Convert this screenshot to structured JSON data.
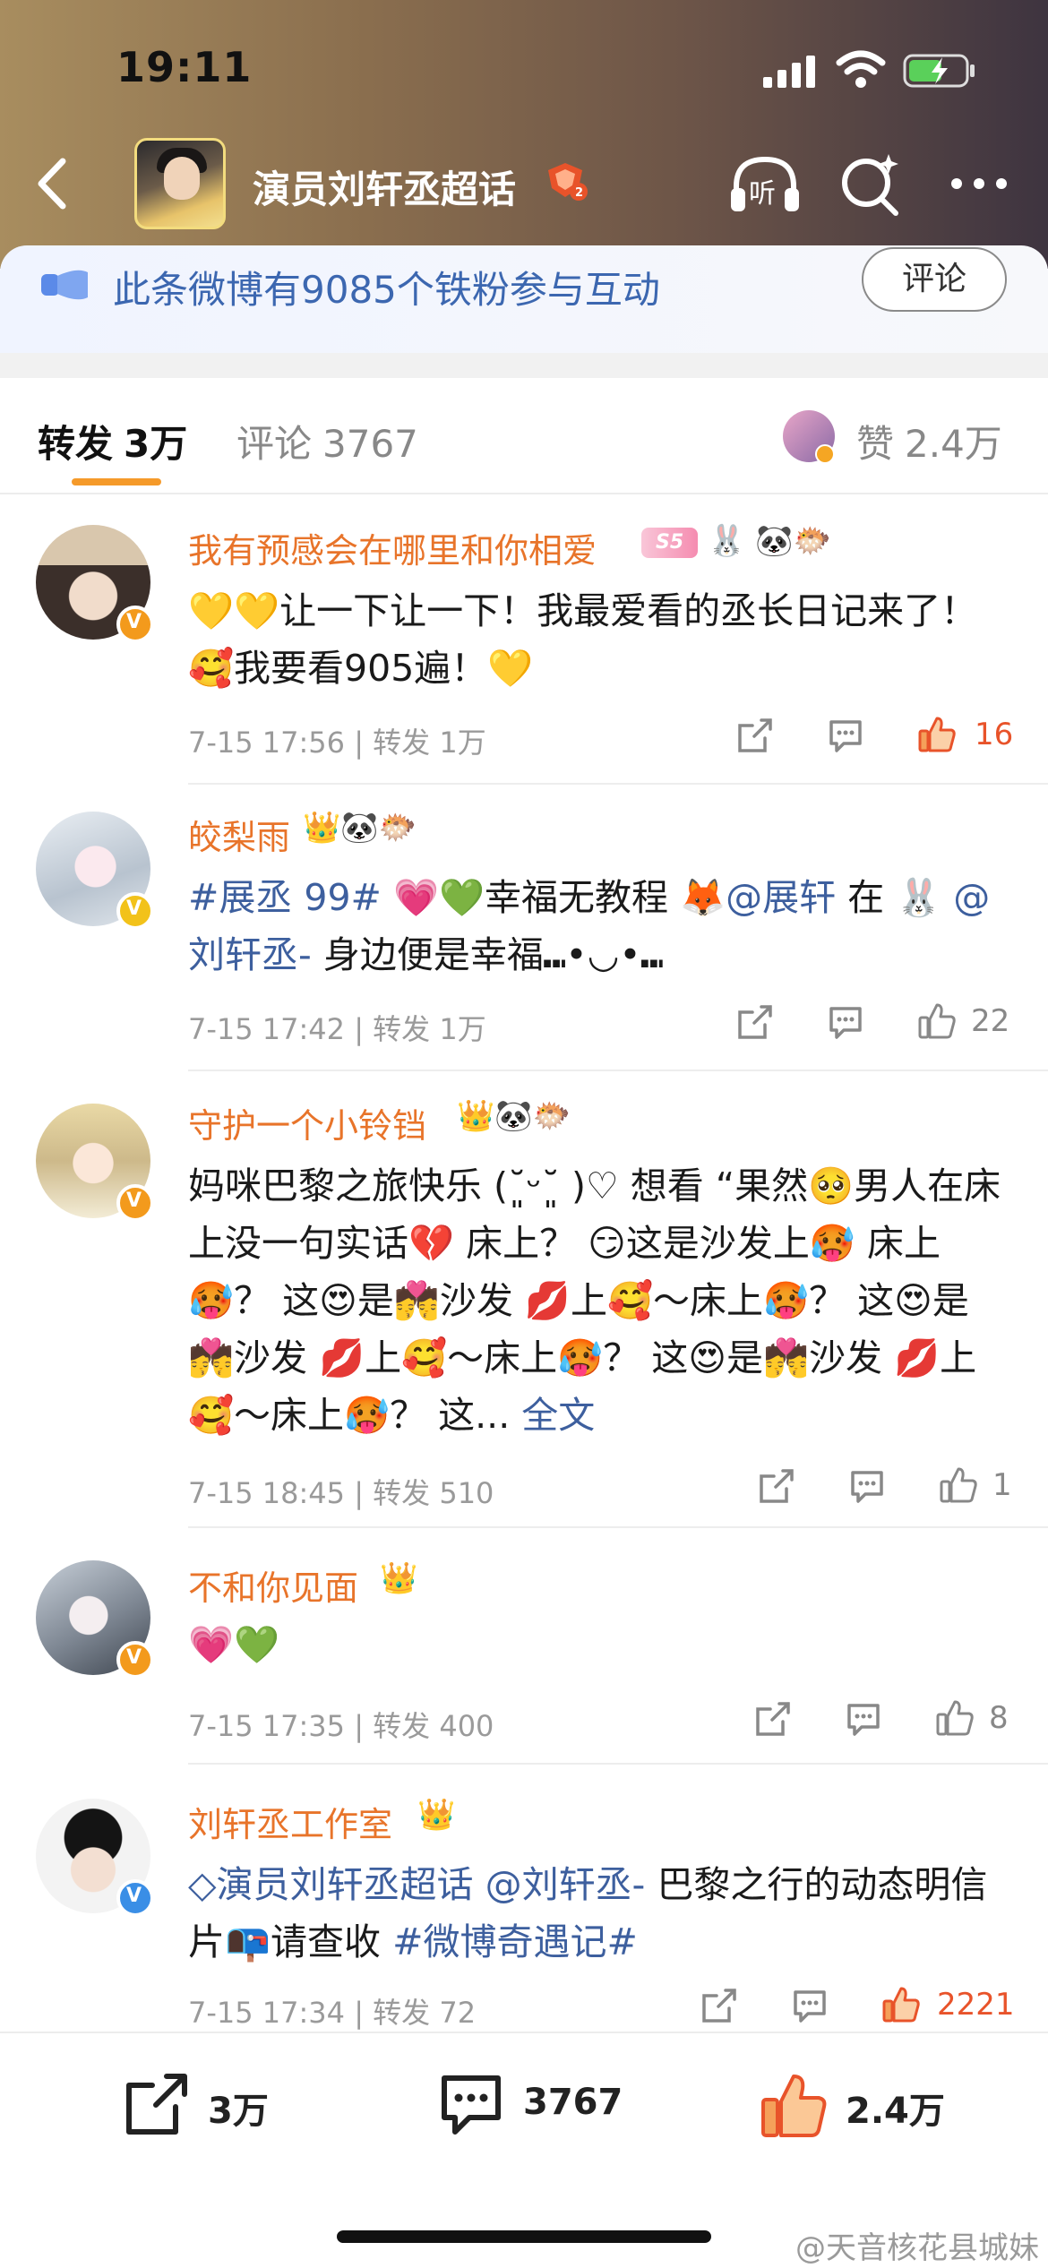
{
  "status_bar": {
    "time": "19:11"
  },
  "nav": {
    "title": "演员刘轩丞超话"
  },
  "fan_banner": {
    "text": "此条微博有9085个铁粉参与互动",
    "comment_button": "评论"
  },
  "tabs": {
    "forward": {
      "label": "转发",
      "count": "3万"
    },
    "comment": {
      "label": "评论",
      "count": "3767"
    },
    "like": {
      "label": "赞",
      "count": "2.4万"
    }
  },
  "comments": [
    {
      "username": "我有预感会在哪里和你相爱",
      "badge_text": "S5",
      "badges": "🐰 🐼🐡",
      "text": "💛💛让一下让一下！我最爱看的丞长日记来了！🥰我要看905遍！💛",
      "time": "7-15 17:56",
      "forward_label": "转发",
      "forwards": "1万",
      "likes": "16"
    },
    {
      "username": "皎梨雨",
      "badges": "👑🐼🐡",
      "text_a": "#展丞 99#",
      "text_b": " 💗💚幸福无教程 🦊",
      "text_c": "@展轩",
      "text_d": " 在 🐰 ",
      "text_e": "@刘轩丞-",
      "text_f": " 身边便是幸福⑉•◡•⑉",
      "time": "7-15 17:42",
      "forward_label": "转发",
      "forwards": "1万",
      "likes": "22"
    },
    {
      "username": "守护一个小铃铛",
      "badges": "👑🐼🐡",
      "text": "妈咪巴黎之旅快乐 (˘͈ᵕ˘͈ )♡ 想看 “果然🥺男人在床上没一句实话💔 床上？ 😏这是沙发上🥵 床上🥵？ 这😍是💏沙发 💋上🥰～床上🥵？ 这😍是💏沙发 💋上🥰～床上🥵？ 这😍是💏沙发 💋上🥰～床上🥵？ 这... ",
      "more_label": "全文",
      "time": "7-15 18:45",
      "forward_label": "转发",
      "forwards": "510",
      "likes": "1"
    },
    {
      "username": "不和你见面",
      "badges": "👑",
      "text": "💗💚",
      "time": "7-15 17:35",
      "forward_label": "转发",
      "forwards": "400",
      "likes": "8"
    },
    {
      "username": "刘轩丞工作室",
      "badges": "👑",
      "text_a": "◇演员刘轩丞超话 @刘轩丞-",
      "text_b": " 巴黎之行的动态明信片📭请查收 ",
      "text_c": "#微博奇遇记#",
      "time": "7-15 17:34",
      "forward_label": "转发",
      "forwards": "72",
      "likes": "2221"
    }
  ],
  "bottom_bar": {
    "forward_count": "3万",
    "comment_count": "3767",
    "like_count": "2.4万"
  },
  "watermark": "@天音核花县城妹",
  "colors": {
    "username": "#e8742a",
    "link": "#3d5f9e",
    "accent": "#f59a2a",
    "like_hot": "#e8532a"
  }
}
